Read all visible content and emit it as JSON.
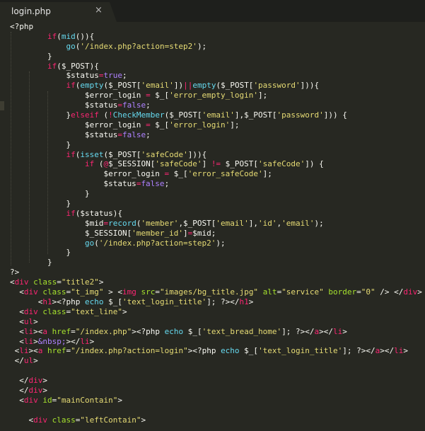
{
  "tab": {
    "title": "login.php",
    "close_glyph": "×",
    "close_icon": "close-icon"
  },
  "colors": {
    "background": "#272822",
    "tabbar": "#1e1f1c",
    "keyword": "#f92672",
    "function": "#66d9ef",
    "string": "#e6db74",
    "attribute": "#a6e22e",
    "boolean": "#ae81ff",
    "text": "#f8f8f2"
  },
  "code": [
    [
      [
        "pl",
        "<?php"
      ]
    ],
    [
      [
        "pl",
        "        "
      ],
      [
        "kw",
        "if"
      ],
      [
        "pl",
        "("
      ],
      [
        "fn",
        "mid"
      ],
      [
        "pl",
        "()){"
      ]
    ],
    [
      [
        "pl",
        "            "
      ],
      [
        "fn",
        "go"
      ],
      [
        "pl",
        "("
      ],
      [
        "st",
        "'/index.php?action=step2'"
      ],
      [
        "pl",
        ");"
      ]
    ],
    [
      [
        "pl",
        "        }"
      ]
    ],
    [
      [
        "pl",
        "        "
      ],
      [
        "kw",
        "if"
      ],
      [
        "pl",
        "($_POST){"
      ]
    ],
    [
      [
        "pl",
        "            $status"
      ],
      [
        "op",
        "="
      ],
      [
        "bl",
        "true"
      ],
      [
        "pl",
        ";"
      ]
    ],
    [
      [
        "pl",
        "            "
      ],
      [
        "kw",
        "if"
      ],
      [
        "pl",
        "("
      ],
      [
        "fn",
        "empty"
      ],
      [
        "pl",
        "($_POST["
      ],
      [
        "st",
        "'email'"
      ],
      [
        "pl",
        "])"
      ],
      [
        "op",
        "||"
      ],
      [
        "fn",
        "empty"
      ],
      [
        "pl",
        "($_POST["
      ],
      [
        "st",
        "'password'"
      ],
      [
        "pl",
        "])){"
      ]
    ],
    [
      [
        "pl",
        "                $error_login "
      ],
      [
        "op",
        "="
      ],
      [
        "pl",
        " $_["
      ],
      [
        "st",
        "'error_empty_login'"
      ],
      [
        "pl",
        "];"
      ]
    ],
    [
      [
        "pl",
        "                $status"
      ],
      [
        "op",
        "="
      ],
      [
        "bl",
        "false"
      ],
      [
        "pl",
        ";"
      ]
    ],
    [
      [
        "pl",
        "            }"
      ],
      [
        "kw",
        "elseif"
      ],
      [
        "pl",
        " ("
      ],
      [
        "op",
        "!"
      ],
      [
        "fn",
        "CheckMember"
      ],
      [
        "pl",
        "($_POST["
      ],
      [
        "st",
        "'email'"
      ],
      [
        "pl",
        "],$_POST["
      ],
      [
        "st",
        "'password'"
      ],
      [
        "pl",
        "])) {"
      ]
    ],
    [
      [
        "pl",
        "                $error_login "
      ],
      [
        "op",
        "="
      ],
      [
        "pl",
        " $_["
      ],
      [
        "st",
        "'error_login'"
      ],
      [
        "pl",
        "];"
      ]
    ],
    [
      [
        "pl",
        "                $status"
      ],
      [
        "op",
        "="
      ],
      [
        "bl",
        "false"
      ],
      [
        "pl",
        ";"
      ]
    ],
    [
      [
        "pl",
        "            }"
      ]
    ],
    [
      [
        "pl",
        "            "
      ],
      [
        "kw",
        "if"
      ],
      [
        "pl",
        "("
      ],
      [
        "fn",
        "isset"
      ],
      [
        "pl",
        "($_POST["
      ],
      [
        "st",
        "'safeCode'"
      ],
      [
        "pl",
        "])){"
      ]
    ],
    [
      [
        "pl",
        "                "
      ],
      [
        "kw",
        "if"
      ],
      [
        "pl",
        " ("
      ],
      [
        "op",
        "@"
      ],
      [
        "pl",
        "$_SESSION["
      ],
      [
        "st",
        "'safeCode'"
      ],
      [
        "pl",
        "] "
      ],
      [
        "op",
        "!="
      ],
      [
        "pl",
        " $_POST["
      ],
      [
        "st",
        "'safeCode'"
      ],
      [
        "pl",
        "]) {"
      ]
    ],
    [
      [
        "pl",
        "                    $error_login "
      ],
      [
        "op",
        "="
      ],
      [
        "pl",
        " $_["
      ],
      [
        "st",
        "'error_safeCode'"
      ],
      [
        "pl",
        "];"
      ]
    ],
    [
      [
        "pl",
        "                    $status"
      ],
      [
        "op",
        "="
      ],
      [
        "bl",
        "false"
      ],
      [
        "pl",
        ";"
      ]
    ],
    [
      [
        "pl",
        "                }"
      ]
    ],
    [
      [
        "pl",
        "            }"
      ]
    ],
    [
      [
        "pl",
        "            "
      ],
      [
        "kw",
        "if"
      ],
      [
        "pl",
        "($status){"
      ]
    ],
    [
      [
        "pl",
        "                $mid"
      ],
      [
        "op",
        "="
      ],
      [
        "fn",
        "record"
      ],
      [
        "pl",
        "("
      ],
      [
        "st",
        "'member'"
      ],
      [
        "pl",
        ",$_POST["
      ],
      [
        "st",
        "'email'"
      ],
      [
        "pl",
        "],"
      ],
      [
        "st",
        "'id'"
      ],
      [
        "pl",
        ","
      ],
      [
        "st",
        "'email'"
      ],
      [
        "pl",
        ");"
      ]
    ],
    [
      [
        "pl",
        "                $_SESSION["
      ],
      [
        "st",
        "'member_id'"
      ],
      [
        "pl",
        "]"
      ],
      [
        "op",
        "="
      ],
      [
        "pl",
        "$mid;"
      ]
    ],
    [
      [
        "pl",
        "                "
      ],
      [
        "fn",
        "go"
      ],
      [
        "pl",
        "("
      ],
      [
        "st",
        "'/index.php?action=step2'"
      ],
      [
        "pl",
        ");"
      ]
    ],
    [
      [
        "pl",
        "            }"
      ]
    ],
    [
      [
        "pl",
        "        }"
      ]
    ],
    [
      [
        "pl",
        "?>"
      ]
    ],
    [
      [
        "pl",
        "<"
      ],
      [
        "tg",
        "div"
      ],
      [
        "pl",
        " "
      ],
      [
        "at",
        "class"
      ],
      [
        "pl",
        "="
      ],
      [
        "st",
        "\"title2\""
      ],
      [
        "pl",
        ">"
      ]
    ],
    [
      [
        "pl",
        "  <"
      ],
      [
        "tg",
        "div"
      ],
      [
        "pl",
        " "
      ],
      [
        "at",
        "class"
      ],
      [
        "pl",
        "="
      ],
      [
        "st",
        "\"t_img\""
      ],
      [
        "pl",
        " > <"
      ],
      [
        "tg",
        "img"
      ],
      [
        "pl",
        " "
      ],
      [
        "at",
        "src"
      ],
      [
        "pl",
        "="
      ],
      [
        "st",
        "\"images/bg_title.jpg\""
      ],
      [
        "pl",
        " "
      ],
      [
        "at",
        "alt"
      ],
      [
        "pl",
        "="
      ],
      [
        "st",
        "\"service\""
      ],
      [
        "pl",
        " "
      ],
      [
        "at",
        "border"
      ],
      [
        "pl",
        "="
      ],
      [
        "st",
        "\"0\""
      ],
      [
        "pl",
        " /> </"
      ],
      [
        "tg",
        "div"
      ],
      [
        "pl",
        ">"
      ]
    ],
    [
      [
        "pl",
        "      <"
      ],
      [
        "tg",
        "h1"
      ],
      [
        "pl",
        "><?php "
      ],
      [
        "fn",
        "echo"
      ],
      [
        "pl",
        " $_["
      ],
      [
        "st",
        "'text_login_title'"
      ],
      [
        "pl",
        "]; ?></"
      ],
      [
        "tg",
        "h1"
      ],
      [
        "pl",
        ">"
      ]
    ],
    [
      [
        "pl",
        "  <"
      ],
      [
        "tg",
        "div"
      ],
      [
        "pl",
        " "
      ],
      [
        "at",
        "class"
      ],
      [
        "pl",
        "="
      ],
      [
        "st",
        "\"text_line\""
      ],
      [
        "pl",
        ">"
      ]
    ],
    [
      [
        "pl",
        "  <"
      ],
      [
        "tg",
        "ul"
      ],
      [
        "pl",
        ">"
      ]
    ],
    [
      [
        "pl",
        "  <"
      ],
      [
        "tg",
        "li"
      ],
      [
        "pl",
        "><"
      ],
      [
        "tg",
        "a"
      ],
      [
        "pl",
        " "
      ],
      [
        "at",
        "href"
      ],
      [
        "pl",
        "="
      ],
      [
        "st",
        "\"/index.php\""
      ],
      [
        "pl",
        "><?php "
      ],
      [
        "fn",
        "echo"
      ],
      [
        "pl",
        " $_["
      ],
      [
        "st",
        "'text_bread_home'"
      ],
      [
        "pl",
        "]; ?></"
      ],
      [
        "tg",
        "a"
      ],
      [
        "pl",
        "></"
      ],
      [
        "tg",
        "li"
      ],
      [
        "pl",
        ">"
      ]
    ],
    [
      [
        "pl",
        "  <"
      ],
      [
        "tg",
        "li"
      ],
      [
        "pl",
        ">"
      ],
      [
        "bl",
        "&nbsp;"
      ],
      [
        "pl",
        "></"
      ],
      [
        "tg",
        "li"
      ],
      [
        "pl",
        ">"
      ]
    ],
    [
      [
        "pl",
        " <"
      ],
      [
        "tg",
        "li"
      ],
      [
        "pl",
        "><"
      ],
      [
        "tg",
        "a"
      ],
      [
        "pl",
        " "
      ],
      [
        "at",
        "href"
      ],
      [
        "pl",
        "="
      ],
      [
        "st",
        "\"/index.php?action=login\""
      ],
      [
        "pl",
        "><?php "
      ],
      [
        "fn",
        "echo"
      ],
      [
        "pl",
        " $_["
      ],
      [
        "st",
        "'text_login_title'"
      ],
      [
        "pl",
        "]; ?></"
      ],
      [
        "tg",
        "a"
      ],
      [
        "pl",
        "></"
      ],
      [
        "tg",
        "li"
      ],
      [
        "pl",
        ">"
      ]
    ],
    [
      [
        "pl",
        " </"
      ],
      [
        "tg",
        "ul"
      ],
      [
        "pl",
        ">"
      ]
    ],
    [
      [
        "pl",
        ""
      ]
    ],
    [
      [
        "pl",
        "  </"
      ],
      [
        "tg",
        "div"
      ],
      [
        "pl",
        ">"
      ]
    ],
    [
      [
        "pl",
        "  </"
      ],
      [
        "tg",
        "div"
      ],
      [
        "pl",
        ">"
      ]
    ],
    [
      [
        "pl",
        "  <"
      ],
      [
        "tg",
        "div"
      ],
      [
        "pl",
        " "
      ],
      [
        "at",
        "id"
      ],
      [
        "pl",
        "="
      ],
      [
        "st",
        "\"mainContain\""
      ],
      [
        "pl",
        ">"
      ]
    ],
    [
      [
        "pl",
        ""
      ]
    ],
    [
      [
        "pl",
        "    <"
      ],
      [
        "tg",
        "div"
      ],
      [
        "pl",
        " "
      ],
      [
        "at",
        "class"
      ],
      [
        "pl",
        "="
      ],
      [
        "st",
        "\"leftContain\""
      ],
      [
        "pl",
        ">"
      ]
    ]
  ]
}
